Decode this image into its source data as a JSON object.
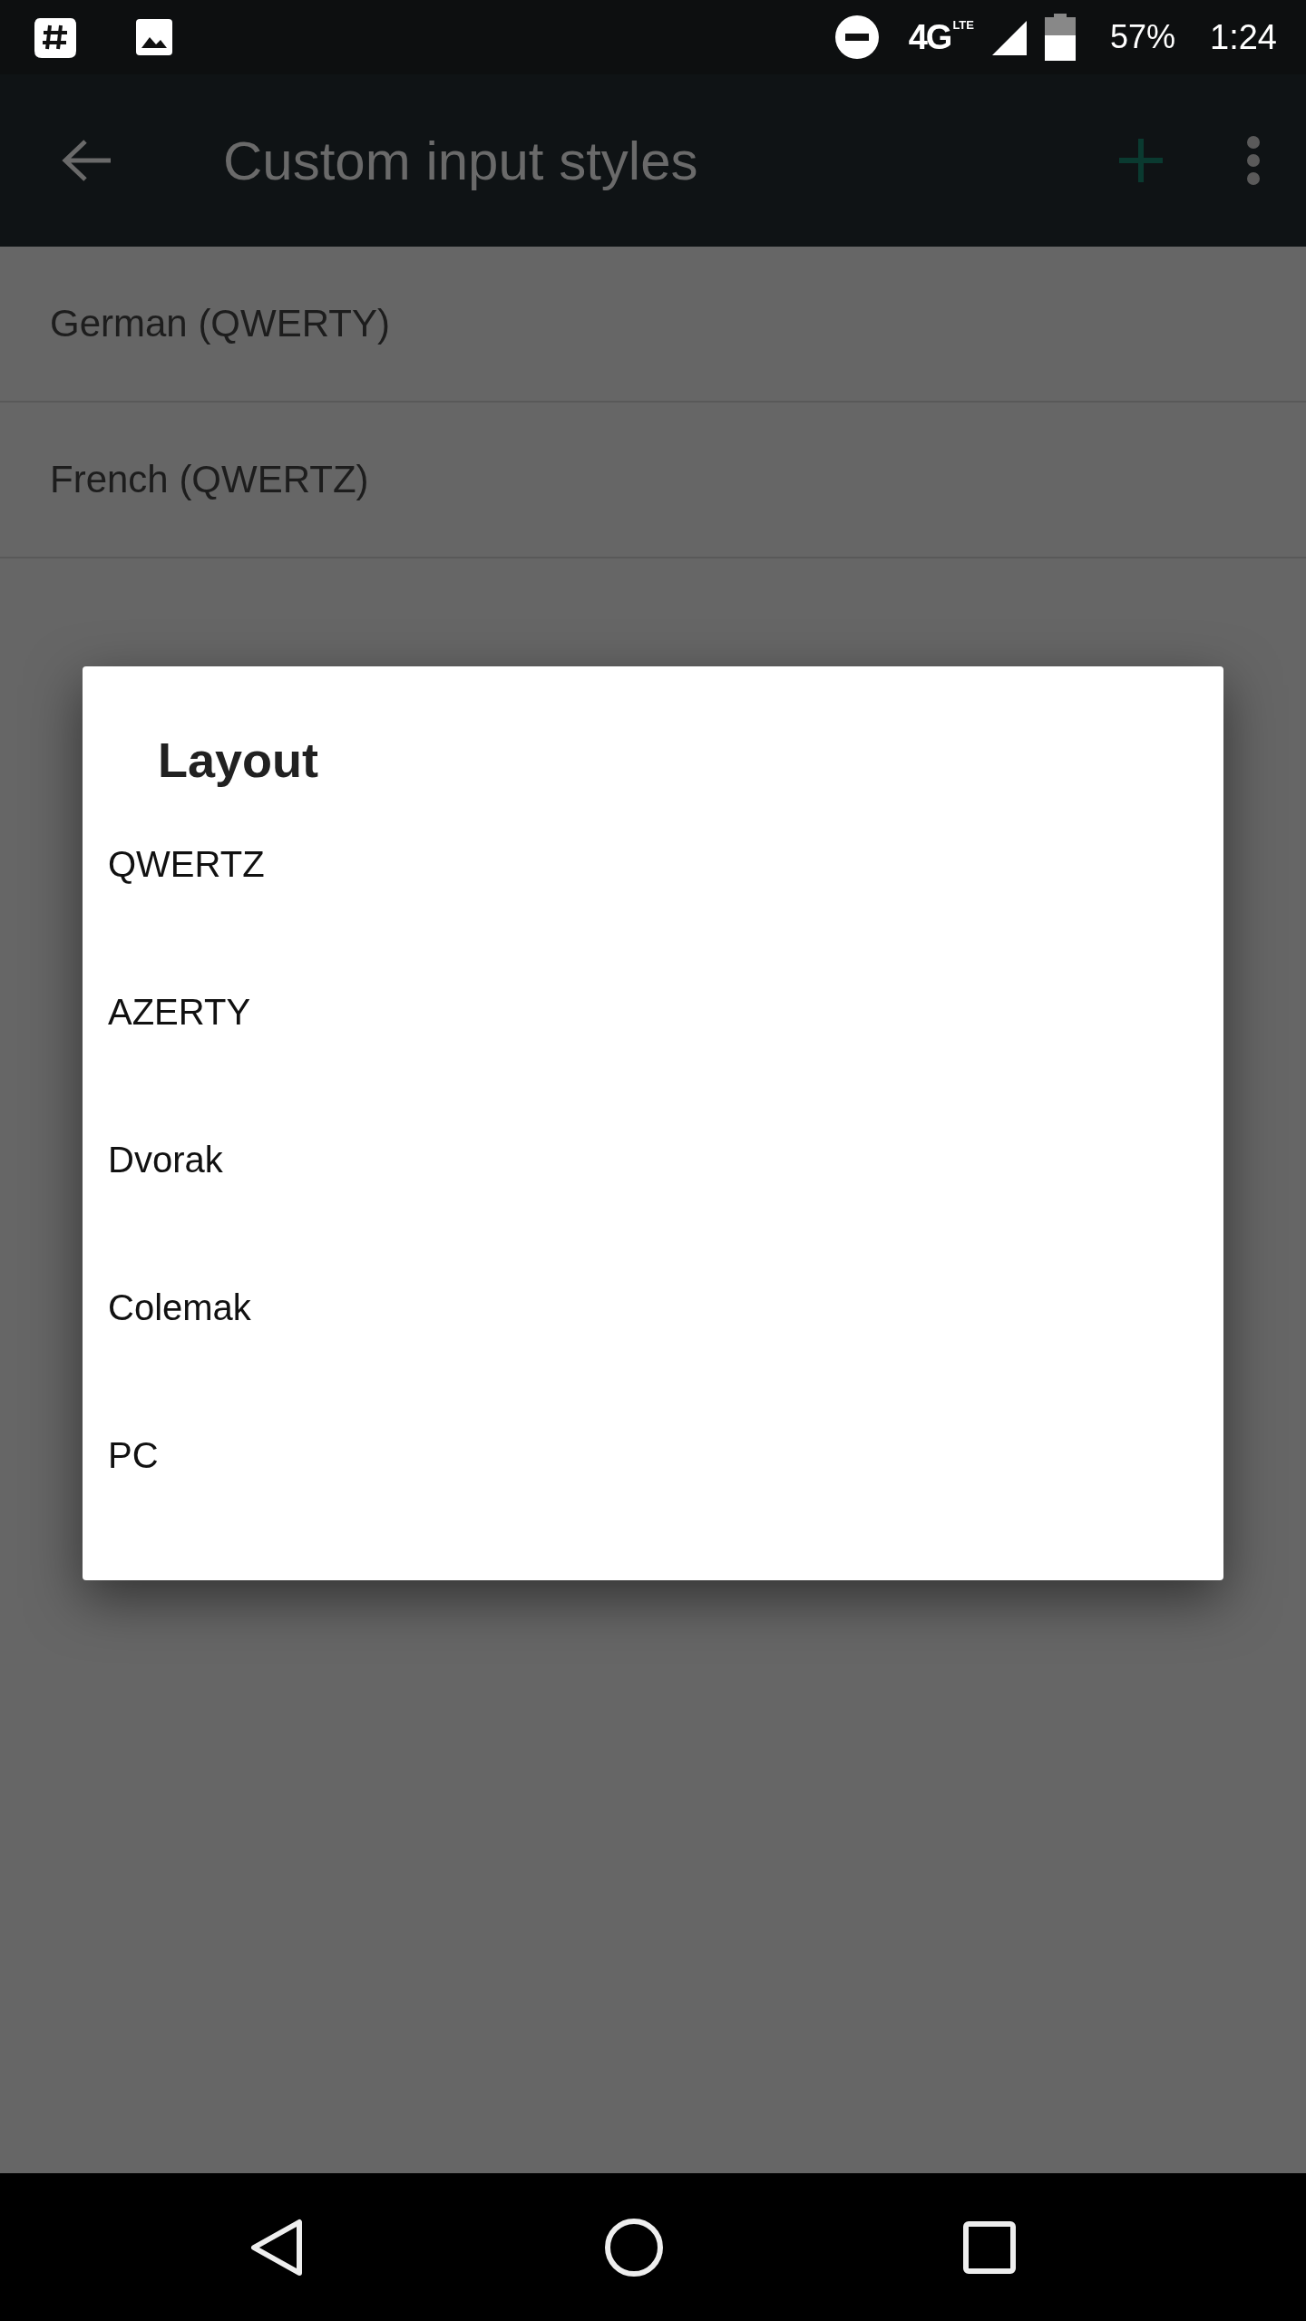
{
  "status_bar": {
    "network": "4G",
    "network_sub": "LTE",
    "battery": "57%",
    "time": "1:24"
  },
  "app_bar": {
    "title": "Custom input styles"
  },
  "styles": [
    {
      "label": "German (QWERTY)"
    },
    {
      "label": "French (QWERTZ)"
    }
  ],
  "dialog": {
    "title": "Layout",
    "options": [
      {
        "label": "QWERTZ"
      },
      {
        "label": "AZERTY"
      },
      {
        "label": "Dvorak"
      },
      {
        "label": "Colemak"
      },
      {
        "label": "PC"
      }
    ]
  }
}
